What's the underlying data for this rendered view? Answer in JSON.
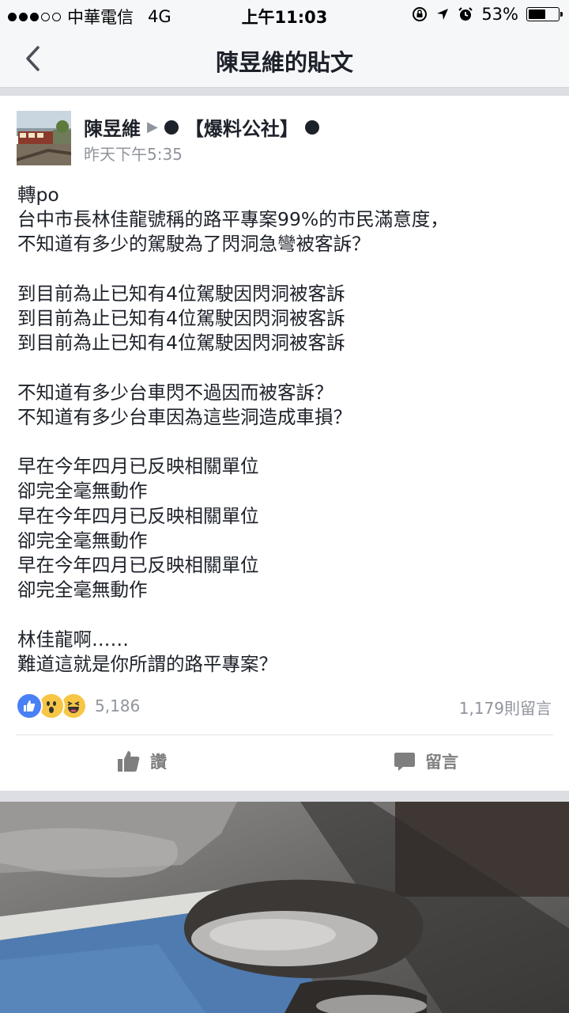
{
  "status_bar": {
    "carrier": "中華電信",
    "network": "4G",
    "time": "上午11:03",
    "battery_percent": "53%",
    "battery_level": 0.53,
    "signal_bars_filled": 3,
    "signal_bars_total": 5
  },
  "nav": {
    "title": "陳昱維的貼文",
    "back_icon": "chevron-left-icon"
  },
  "post": {
    "author": "陳昱維",
    "target_page": "【爆料公社】",
    "timestamp": "昨天下午5:35",
    "text": "轉po\n台中市長林佳龍號稱的路平專案99%的市民滿意度，\n不知道有多少的駕駛為了閃洞急彎被客訴？\n\n到目前為止已知有4位駕駛因閃洞被客訴\n到目前為止已知有4位駕駛因閃洞被客訴\n到目前為止已知有4位駕駛因閃洞被客訴\n\n不知道有多少台車閃不過因而被客訴？\n不知道有多少台車因為這些洞造成車損？\n\n早在今年四月已反映相關單位\n卻完全毫無動作\n早在今年四月已反映相關單位\n卻完全毫無動作\n早在今年四月已反映相關單位\n卻完全毫無動作\n\n林佳龍啊……\n難道這就是你所謂的路平專案？",
    "reaction_count": "5,186",
    "comment_count": "1,179則留言",
    "like_label": "讚",
    "comment_label": "留言"
  },
  "colors": {
    "accent_blue": "#4a80f5",
    "reaction_yellow": "#f7c646",
    "muted_text": "#90949c",
    "separator": "#dcdee3"
  }
}
